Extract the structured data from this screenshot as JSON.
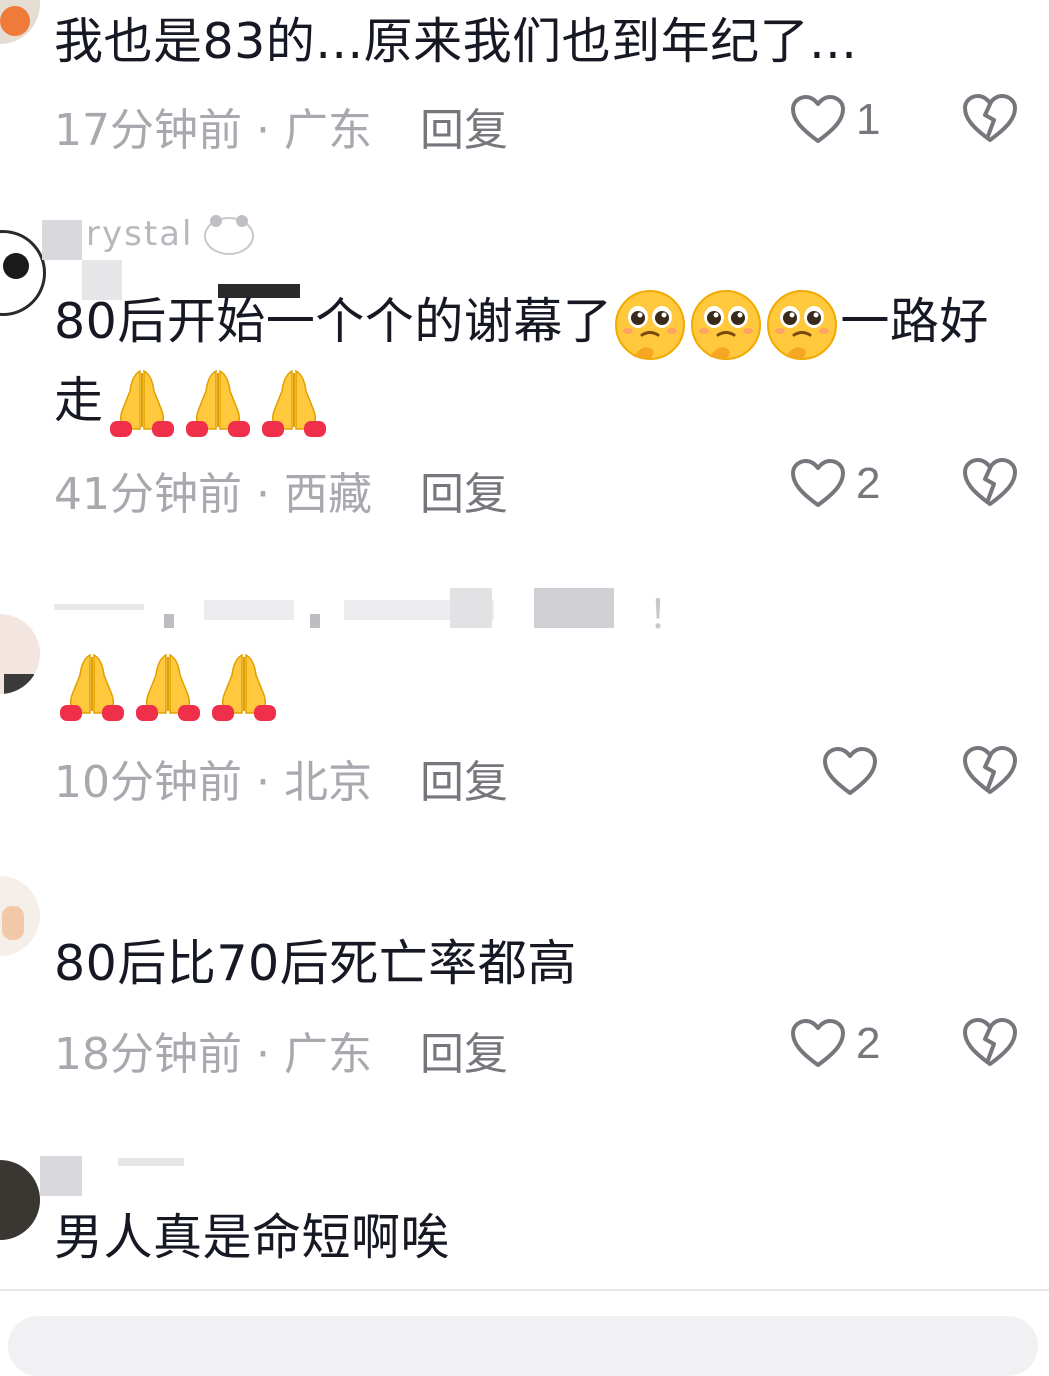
{
  "comments": [
    {
      "text": "我也是83的...原来我们也到年纪了...",
      "time": "17分钟前",
      "location": "广东",
      "reply_label": "回复",
      "likes": "1"
    },
    {
      "username_fragment": "rystal",
      "text_before": "80后开始一个个的谢幕了",
      "text_after": "一路好",
      "text_line2": "走",
      "emoji_a": "pleading-face",
      "emoji_b": "folded-hands",
      "time": "41分钟前",
      "location": "西藏",
      "reply_label": "回复",
      "likes": "2"
    },
    {
      "partial_text": "！",
      "emoji": "folded-hands",
      "time": "10分钟前",
      "location": "北京",
      "reply_label": "回复",
      "likes": ""
    },
    {
      "text": "80后比70后死亡率都高",
      "time": "18分钟前",
      "location": "广东",
      "reply_label": "回复",
      "likes": "2"
    },
    {
      "text": "男人真是命短啊唉"
    }
  ],
  "separator": " · ",
  "colors": {
    "text": "#161823",
    "meta": "#a8a9ae",
    "action": "#76777d",
    "emoji_yellow": "#ffc83d",
    "hands_red": "#f0304a"
  }
}
